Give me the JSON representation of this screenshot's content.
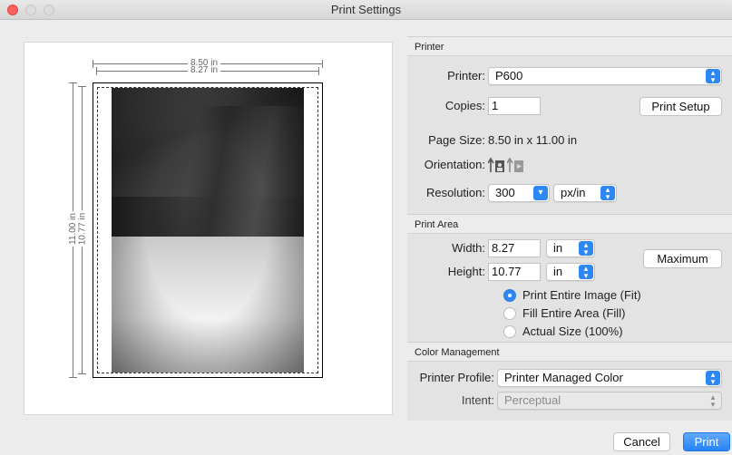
{
  "window": {
    "title": "Print Settings"
  },
  "preview": {
    "width_outer": "8.50 in",
    "width_inner": "8.27 in",
    "height_outer": "11.00 in",
    "height_inner": "10.77 in"
  },
  "printer_section": {
    "heading": "Printer",
    "printer_label": "Printer:",
    "printer_value": "P600",
    "copies_label": "Copies:",
    "copies_value": "1",
    "print_setup_label": "Print Setup",
    "page_size_label": "Page Size:",
    "page_size_value": "8.50 in x 11.00 in",
    "orientation_label": "Orientation:",
    "orientation_icons": [
      "portrait-icon",
      "landscape-icon"
    ],
    "resolution_label": "Resolution:",
    "resolution_value": "300",
    "resolution_unit": "px/in"
  },
  "print_area": {
    "heading": "Print Area",
    "width_label": "Width:",
    "width_value": "8.27",
    "width_unit": "in",
    "height_label": "Height:",
    "height_value": "10.77",
    "height_unit": "in",
    "maximum_label": "Maximum",
    "options": [
      {
        "label": "Print Entire Image (Fit)",
        "selected": true
      },
      {
        "label": "Fill Entire Area (Fill)",
        "selected": false
      },
      {
        "label": "Actual Size (100%)",
        "selected": false
      }
    ]
  },
  "color_management": {
    "heading": "Color Management",
    "profile_label": "Printer Profile:",
    "profile_value": "Printer Managed Color",
    "intent_label": "Intent:",
    "intent_value": "Perceptual"
  },
  "footer": {
    "cancel_label": "Cancel",
    "print_label": "Print"
  },
  "colors": {
    "accent": "#2e88f3",
    "close": "#fc605c"
  }
}
